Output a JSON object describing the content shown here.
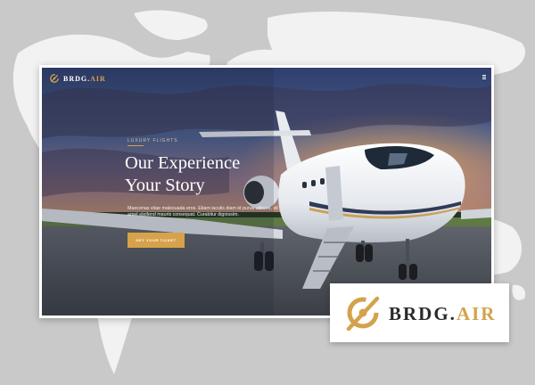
{
  "navbar": {
    "logo_primary": "BRDG.",
    "logo_accent": "AIR",
    "menu_icon": "hamburger-icon"
  },
  "hero": {
    "eyebrow": "LUXURY FLIGHTS",
    "title_line1": "Our Experience",
    "title_line2": "Your Story",
    "body": "Maecenas vitae malesuada eros. Etiam iaculis diam id purus ultrices, sit amet eleifend mauris consequat. Curabitur dignissim.",
    "cta_label": "GET YOUR TICKET"
  },
  "brand_badge": {
    "primary": "BRDG.",
    "accent": "AIR"
  },
  "colors": {
    "accent_gold": "#d4a24c",
    "background_gray": "#c9c9c9",
    "map_land": "#f2f2f2"
  }
}
